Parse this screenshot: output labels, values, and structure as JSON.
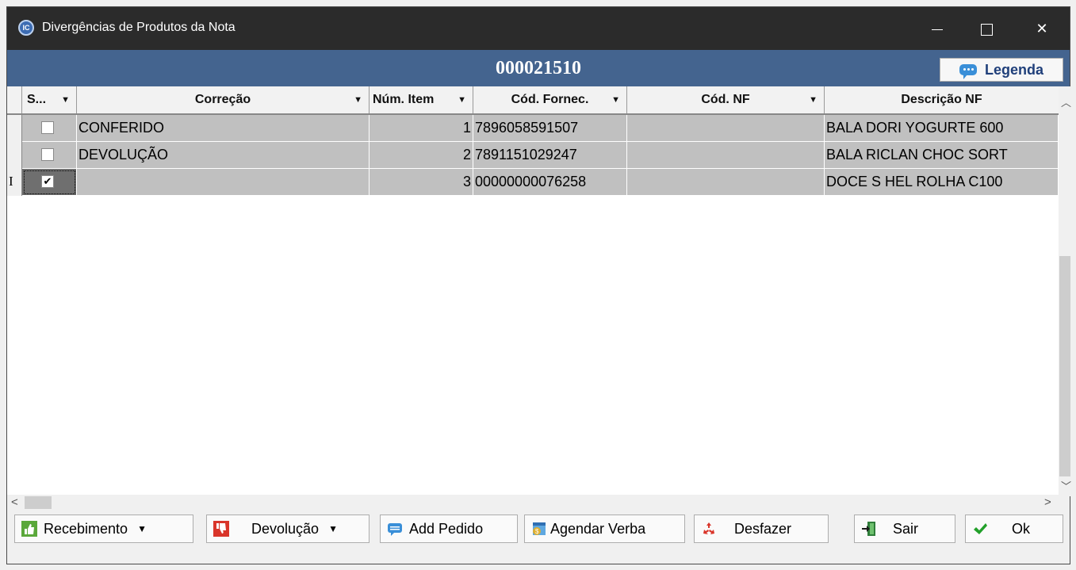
{
  "window": {
    "title": "Divergências de Produtos da Nota",
    "app_icon": "IC"
  },
  "header": {
    "note_number": "000021510",
    "legend_label": "Legenda"
  },
  "table": {
    "columns": [
      "S...",
      "Correção",
      "Núm. Item",
      "Cód. Fornec.",
      "Cód. NF",
      "Descrição NF"
    ],
    "rows": [
      {
        "selected": false,
        "correcao": "CONFERIDO",
        "num_item": "1",
        "cod_fornec": "7896058591507",
        "cod_nf": "",
        "descricao": "BALA DORI YOGURTE 600"
      },
      {
        "selected": false,
        "correcao": "DEVOLUÇÃO",
        "num_item": "2",
        "cod_fornec": "7891151029247",
        "cod_nf": "",
        "descricao": "BALA RICLAN CHOC SORT"
      },
      {
        "selected": true,
        "correcao": "",
        "num_item": "3",
        "cod_fornec": "00000000076258",
        "cod_nf": "",
        "descricao": "DOCE S HEL ROLHA C100"
      }
    ]
  },
  "toolbar": {
    "recebimento": "Recebimento",
    "devolucao": "Devolução",
    "add_pedido": "Add Pedido",
    "agendar_verba": "Agendar Verba",
    "desfazer": "Desfazer",
    "sair": "Sair",
    "ok": "Ok"
  },
  "colors": {
    "header_bar": "#44648f",
    "title_bar": "#2b2b2b",
    "row_bg": "#c0c0c0"
  }
}
